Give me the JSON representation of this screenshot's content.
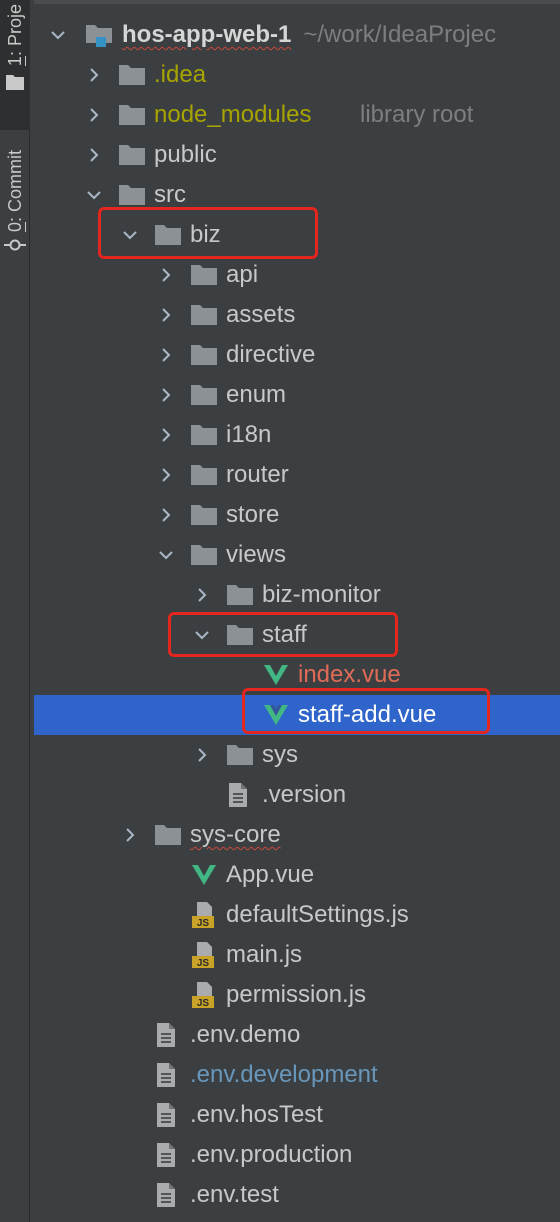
{
  "side_tabs": {
    "project": {
      "number": "1",
      "label": "Proje"
    },
    "commit": {
      "number": "0",
      "label": "Commit"
    }
  },
  "tree": {
    "root": {
      "name": "hos-app-web-1",
      "path": "~/work/IdeaProjec"
    },
    "items": [
      {
        "name": ".idea"
      },
      {
        "name": "node_modules",
        "hint": "library root"
      },
      {
        "name": "public"
      },
      {
        "name": "src"
      },
      {
        "name": "biz"
      },
      {
        "name": "api"
      },
      {
        "name": "assets"
      },
      {
        "name": "directive"
      },
      {
        "name": "enum"
      },
      {
        "name": "i18n"
      },
      {
        "name": "router"
      },
      {
        "name": "store"
      },
      {
        "name": "views"
      },
      {
        "name": "biz-monitor"
      },
      {
        "name": "staff"
      },
      {
        "name": "index.vue"
      },
      {
        "name": "staff-add.vue"
      },
      {
        "name": "sys"
      },
      {
        "name": ".version"
      },
      {
        "name": "sys-core"
      },
      {
        "name": "App.vue"
      },
      {
        "name": "defaultSettings.js"
      },
      {
        "name": "main.js"
      },
      {
        "name": "permission.js"
      },
      {
        "name": ".env.demo"
      },
      {
        "name": ".env.development"
      },
      {
        "name": ".env.hosTest"
      },
      {
        "name": ".env.production"
      },
      {
        "name": ".env.test"
      }
    ]
  },
  "colors": {
    "background": "#3c3f41",
    "selection": "#2f65ca",
    "folder": "#8c9196",
    "vue_green": "#41b883",
    "js_badge": "#c9a227",
    "highlight_box": "#e3261e"
  }
}
